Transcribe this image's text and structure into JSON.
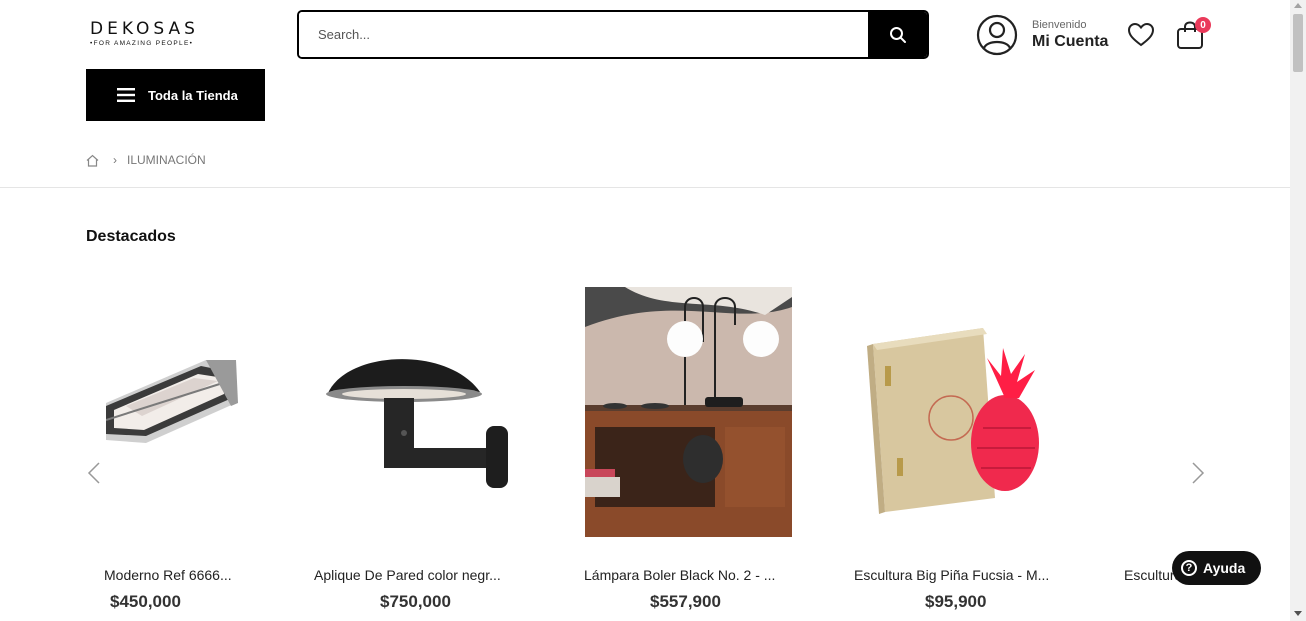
{
  "header": {
    "logo_main": "DEKOSAS",
    "logo_sub": "•FOR AMAZING PEOPLE•",
    "search_placeholder": "Search...",
    "welcome": "Bienvenido",
    "account_label": "Mi Cuenta",
    "cart_count": "0"
  },
  "nav": {
    "store_button": "Toda la Tienda"
  },
  "breadcrumb": {
    "current": "ILUMINACIÓN"
  },
  "section": {
    "title": "Destacados"
  },
  "products": [
    {
      "name": "Moderno Ref 6666...",
      "price": "$450,000"
    },
    {
      "name": "Aplique De Pared color negr...",
      "price": "$750,000"
    },
    {
      "name": "Lámpara Boler Black No. 2 - ...",
      "price": "$557,900"
    },
    {
      "name": "Escultura Big Piña Fucsia - M...",
      "price": "$95,900"
    },
    {
      "name": "Escultura",
      "price": ""
    }
  ],
  "help": {
    "label": "Ayuda"
  },
  "icons": {
    "search": "search-icon",
    "user": "user-icon",
    "wishlist": "heart-icon",
    "cart": "shopping-bag-icon",
    "menu": "hamburger-icon",
    "home": "home-icon",
    "prev": "chevron-left-icon",
    "next": "chevron-right-icon",
    "help": "question-icon"
  },
  "colors": {
    "accent": "#000000",
    "badge": "#ea3a5a"
  }
}
